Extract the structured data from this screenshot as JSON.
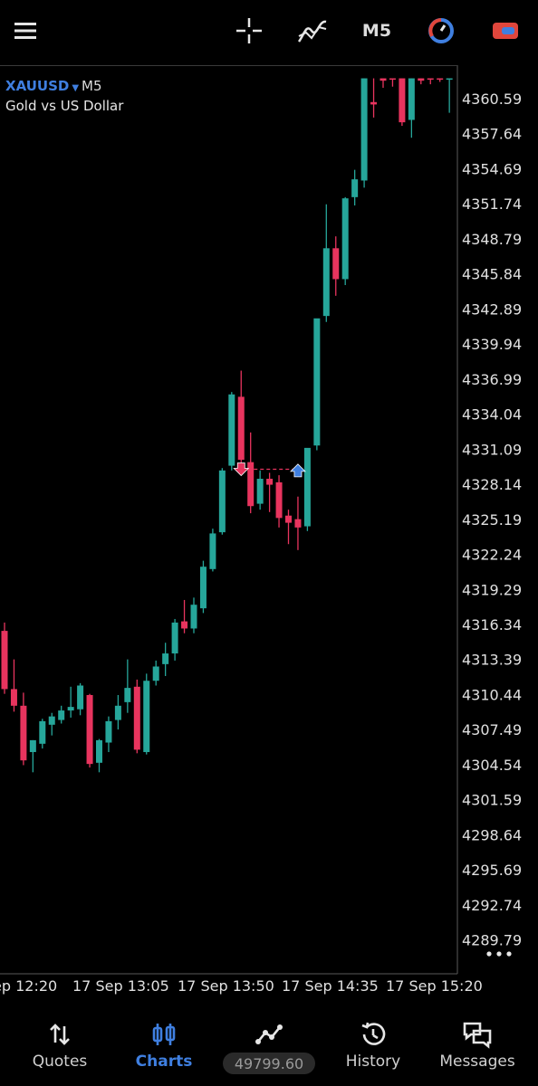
{
  "toolbar": {
    "timeframe": "M5",
    "icons": [
      "menu-icon",
      "crosshair-icon",
      "indicators-icon",
      "trade-icon",
      "chart-switch-icon"
    ]
  },
  "symbol": {
    "ticker": "XAUUSD",
    "timeframe": "M5",
    "description": "Gold vs US Dollar"
  },
  "colors": {
    "bull": "#26a69a",
    "bear": "#e8345e",
    "accent": "#3f7fe0",
    "background": "#000000"
  },
  "chart_data": {
    "type": "candlestick",
    "title": "",
    "y_ticks": [
      "4360.59",
      "4357.64",
      "4354.69",
      "4351.74",
      "4348.79",
      "4345.84",
      "4342.89",
      "4339.94",
      "4336.99",
      "4334.04",
      "4331.09",
      "4328.14",
      "4325.19",
      "4322.24",
      "4319.29",
      "4316.34",
      "4313.39",
      "4310.44",
      "4307.49",
      "4304.54",
      "4301.59",
      "4298.64",
      "4295.69",
      "4292.74",
      "4289.79"
    ],
    "ylim": [
      4288.0,
      4362.3
    ],
    "x_ticks": [
      "ep 12:20",
      "17 Sep 13:05",
      "17 Sep 13:50",
      "17 Sep 14:35",
      "17 Sep 15:20"
    ],
    "candles": [
      {
        "o": 4315.8,
        "h": 4316.5,
        "c": 4310.9,
        "l": 4310.5
      },
      {
        "o": 4310.9,
        "h": 4313.4,
        "c": 4309.5,
        "l": 4309.0
      },
      {
        "o": 4309.5,
        "h": 4310.6,
        "c": 4304.9,
        "l": 4304.5
      },
      {
        "o": 4305.6,
        "h": 4306.6,
        "c": 4306.6,
        "l": 4303.9
      },
      {
        "o": 4306.3,
        "h": 4308.4,
        "c": 4308.2,
        "l": 4305.9
      },
      {
        "o": 4307.9,
        "h": 4308.9,
        "c": 4308.6,
        "l": 4307.0
      },
      {
        "o": 4308.3,
        "h": 4309.5,
        "c": 4309.1,
        "l": 4308.0
      },
      {
        "o": 4309.1,
        "h": 4311.1,
        "c": 4309.4,
        "l": 4308.5
      },
      {
        "o": 4309.2,
        "h": 4311.4,
        "c": 4311.2,
        "l": 4308.7
      },
      {
        "o": 4310.4,
        "h": 4310.5,
        "c": 4304.6,
        "l": 4304.3
      },
      {
        "o": 4304.7,
        "h": 4306.7,
        "c": 4306.6,
        "l": 4303.9
      },
      {
        "o": 4306.4,
        "h": 4308.6,
        "c": 4308.2,
        "l": 4305.6
      },
      {
        "o": 4308.3,
        "h": 4310.4,
        "c": 4309.5,
        "l": 4307.5
      },
      {
        "o": 4309.8,
        "h": 4313.4,
        "c": 4311.0,
        "l": 4308.9
      },
      {
        "o": 4311.1,
        "h": 4311.7,
        "c": 4305.8,
        "l": 4305.5
      },
      {
        "o": 4305.6,
        "h": 4312.2,
        "c": 4311.6,
        "l": 4305.4
      },
      {
        "o": 4311.6,
        "h": 4313.3,
        "c": 4312.8,
        "l": 4311.2
      },
      {
        "o": 4313.0,
        "h": 4314.8,
        "c": 4313.9,
        "l": 4312.0
      },
      {
        "o": 4313.9,
        "h": 4316.8,
        "c": 4316.5,
        "l": 4313.3
      },
      {
        "o": 4316.6,
        "h": 4318.4,
        "c": 4316.0,
        "l": 4315.6
      },
      {
        "o": 4316.0,
        "h": 4318.6,
        "c": 4318.0,
        "l": 4315.6
      },
      {
        "o": 4317.7,
        "h": 4321.7,
        "c": 4321.2,
        "l": 4317.3
      },
      {
        "o": 4321.0,
        "h": 4324.4,
        "c": 4324.0,
        "l": 4320.8
      },
      {
        "o": 4324.1,
        "h": 4329.5,
        "c": 4329.3,
        "l": 4323.9
      },
      {
        "o": 4329.7,
        "h": 4335.9,
        "c": 4335.7,
        "l": 4329.3
      },
      {
        "o": 4335.5,
        "h": 4337.7,
        "c": 4330.2,
        "l": 4329.9
      },
      {
        "o": 4330.0,
        "h": 4332.5,
        "c": 4326.3,
        "l": 4325.7
      },
      {
        "o": 4326.5,
        "h": 4329.3,
        "c": 4328.6,
        "l": 4326.0
      },
      {
        "o": 4328.6,
        "h": 4329.1,
        "c": 4328.1,
        "l": 4325.8
      },
      {
        "o": 4328.3,
        "h": 4328.9,
        "c": 4325.3,
        "l": 4324.5
      },
      {
        "o": 4325.5,
        "h": 4326.0,
        "c": 4324.9,
        "l": 4323.1
      },
      {
        "o": 4325.2,
        "h": 4327.1,
        "c": 4324.5,
        "l": 4322.6
      },
      {
        "o": 4324.6,
        "h": 4327.2,
        "c": 4331.2,
        "l": 4324.2
      },
      {
        "o": 4331.4,
        "h": 4331.7,
        "c": 4342.1,
        "l": 4331.0
      },
      {
        "o": 4342.3,
        "h": 4351.7,
        "c": 4348.0,
        "l": 4341.8
      },
      {
        "o": 4348.0,
        "h": 4349.0,
        "c": 4345.4,
        "l": 4344.0
      },
      {
        "o": 4345.4,
        "h": 4352.3,
        "c": 4352.2,
        "l": 4344.9
      },
      {
        "o": 4352.3,
        "h": 4354.6,
        "c": 4353.8,
        "l": 4351.6
      },
      {
        "o": 4353.7,
        "h": 4362.3,
        "c": 4362.3,
        "l": 4353.1
      },
      {
        "o": 4360.3,
        "h": 4362.3,
        "c": 4360.1,
        "l": 4359.0
      },
      {
        "o": 4362.3,
        "h": 4362.3,
        "c": 4362.1,
        "l": 4361.5
      },
      {
        "o": 4362.3,
        "h": 4362.3,
        "c": 4362.2,
        "l": 4361.6
      },
      {
        "o": 4362.3,
        "h": 4362.3,
        "c": 4358.6,
        "l": 4358.3
      },
      {
        "o": 4358.8,
        "h": 4362.3,
        "c": 4362.3,
        "l": 4357.3
      },
      {
        "o": 4362.3,
        "h": 4362.3,
        "c": 4362.1,
        "l": 4361.8
      },
      {
        "o": 4362.3,
        "h": 4362.3,
        "c": 4362.2,
        "l": 4361.8
      },
      {
        "o": 4362.3,
        "h": 4362.3,
        "c": 4362.2,
        "l": 4362.0
      },
      {
        "o": 4362.3,
        "h": 4362.3,
        "c": 4362.3,
        "l": 4359.4
      }
    ],
    "trade_markers": [
      {
        "type": "sell",
        "candle": 25,
        "price": 4329.4
      },
      {
        "type": "buy",
        "candle": 31,
        "price": 4329.3
      }
    ]
  },
  "more_icon": "more-dots-icon",
  "bottom_nav": [
    {
      "label": "Quotes",
      "icon": "quotes-icon",
      "active": false
    },
    {
      "label": "Charts",
      "icon": "charts-icon",
      "active": true
    },
    {
      "label": "",
      "icon": "trade-graph-icon",
      "active": false
    },
    {
      "label": "History",
      "icon": "history-icon",
      "active": false
    },
    {
      "label": "Messages",
      "icon": "messages-icon",
      "active": false
    }
  ],
  "balance": "49799.60"
}
